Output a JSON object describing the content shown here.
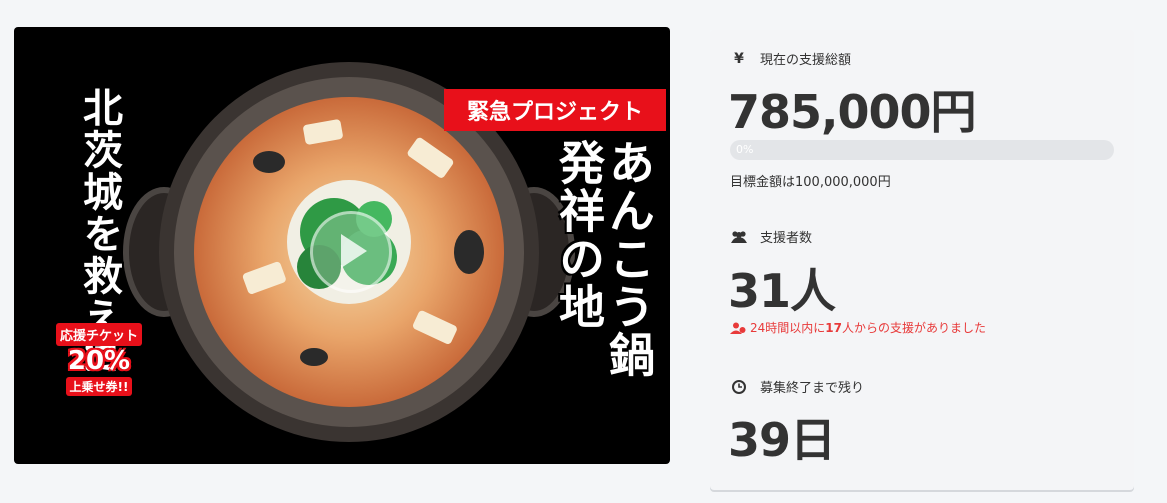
{
  "hero": {
    "banner": "緊急プロジェクト",
    "left_text": "北茨城を救え!!",
    "right_text": "あんこう鍋\n発祥の地",
    "ticket": {
      "line1": "応援チケット",
      "line2": "20%",
      "line3": "上乗せ券!!"
    }
  },
  "funding": {
    "icon": "yen-icon",
    "label": "現在の支援総額",
    "amount": "785,000円",
    "progress_label": "0%",
    "progress_fraction": 0.0,
    "goal": "目標金額は100,000,000円"
  },
  "supporters": {
    "icon": "users-icon",
    "label": "支援者数",
    "count": "31人",
    "recent_prefix": "24時間以内に",
    "recent_number": "17",
    "recent_suffix": "人からの支援がありました",
    "recent_color": "#e83a3a"
  },
  "remaining": {
    "icon": "clock-icon",
    "label": "募集終了まで残り",
    "days": "39日"
  },
  "colors": {
    "accent_red": "#e8101a",
    "progress_track": "#e3e5e8"
  }
}
